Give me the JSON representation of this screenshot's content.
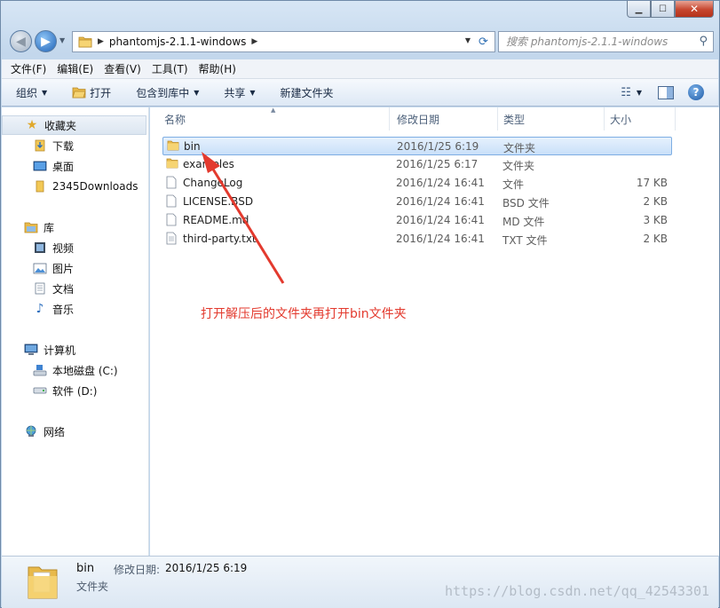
{
  "window": {
    "minimize_icon": "minimize-icon",
    "maximize_icon": "maximize-icon",
    "close_icon": "close-icon"
  },
  "address": {
    "path": "phantomjs-2.1.1-windows",
    "search_placeholder": "搜索 phantomjs-2.1.1-windows"
  },
  "menu": [
    "文件(F)",
    "编辑(E)",
    "查看(V)",
    "工具(T)",
    "帮助(H)"
  ],
  "toolbar": {
    "organize": "组织",
    "open": "打开",
    "include_library": "包含到库中",
    "share": "共享",
    "new_folder": "新建文件夹"
  },
  "nav": {
    "favorites": "收藏夹",
    "downloads": "下载",
    "desktop": "桌面",
    "downloads_2345": "2345Downloads",
    "libraries": "库",
    "videos": "视频",
    "pictures": "图片",
    "documents": "文档",
    "music": "音乐",
    "computer": "计算机",
    "local_disk": "本地磁盘 (C:)",
    "software_disk": "软件 (D:)",
    "network": "网络"
  },
  "columns": {
    "name": "名称",
    "modified": "修改日期",
    "type": "类型",
    "size": "大小"
  },
  "files": [
    {
      "name": "bin",
      "modified": "2016/1/25 6:19",
      "type": "文件夹",
      "size": "",
      "icon": "folder-icon"
    },
    {
      "name": "examples",
      "modified": "2016/1/25 6:17",
      "type": "文件夹",
      "size": "",
      "icon": "folder-icon"
    },
    {
      "name": "ChangeLog",
      "modified": "2016/1/24 16:41",
      "type": "文件",
      "size": "17 KB",
      "icon": "file-icon"
    },
    {
      "name": "LICENSE.BSD",
      "modified": "2016/1/24 16:41",
      "type": "BSD 文件",
      "size": "2 KB",
      "icon": "file-icon"
    },
    {
      "name": "README.md",
      "modified": "2016/1/24 16:41",
      "type": "MD 文件",
      "size": "3 KB",
      "icon": "file-icon"
    },
    {
      "name": "third-party.txt",
      "modified": "2016/1/24 16:41",
      "type": "TXT 文件",
      "size": "2 KB",
      "icon": "text-file-icon"
    }
  ],
  "annotation": "打开解压后的文件夹再打开bin文件夹",
  "details": {
    "name": "bin",
    "modified_label": "修改日期:",
    "modified_value": "2016/1/25 6:19",
    "type": "文件夹"
  },
  "watermark": "https://blog.csdn.net/qq_42543301",
  "colors": {
    "annotation": "#e33a2e",
    "selection": "#cce4fa"
  }
}
